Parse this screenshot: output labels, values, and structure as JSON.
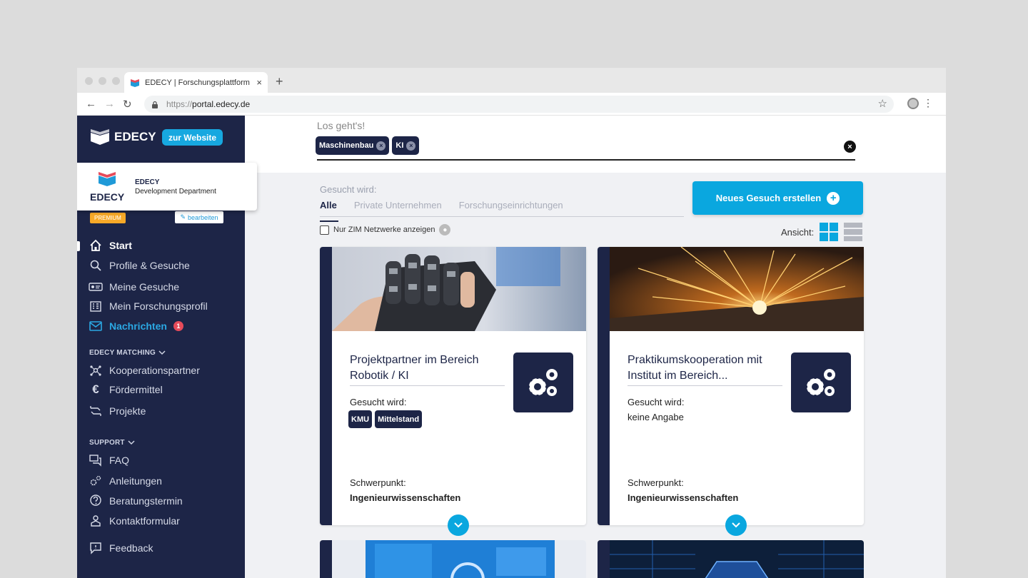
{
  "browser": {
    "tab_title": "EDECY | Forschungsplattform",
    "tab_close": "×",
    "new_tab": "+",
    "url_protocol": "https://",
    "url_host": "portal.edecy.de",
    "back": "←",
    "forward": "→",
    "reload": "↻",
    "star": "☆",
    "menu": "⋮"
  },
  "sidebar": {
    "brand": "EDECY",
    "website_button": "zur Website",
    "profile": {
      "logo_text": "EDECY",
      "name": "EDECY",
      "department": "Development Department",
      "premium": "PREMIUM",
      "edit": "bearbeiten"
    },
    "items": [
      {
        "label": "Start",
        "icon": "home-icon"
      },
      {
        "label": "Profile & Gesuche",
        "icon": "search-icon"
      },
      {
        "label": "Meine Gesuche",
        "icon": "id-card-icon"
      },
      {
        "label": "Mein Forschungsprofil",
        "icon": "building-icon"
      },
      {
        "label": "Nachrichten",
        "icon": "mail-icon",
        "badge": "1"
      }
    ],
    "matching": {
      "heading": "EDECY MATCHING",
      "items": [
        {
          "label": "Kooperationspartner",
          "icon": "network-icon"
        },
        {
          "label": "Fördermittel",
          "icon": "euro-icon"
        },
        {
          "label": "Projekte",
          "icon": "project-icon"
        }
      ]
    },
    "support": {
      "heading": "SUPPORT",
      "items": [
        {
          "label": "FAQ",
          "icon": "chat-icon"
        },
        {
          "label": "Anleitungen",
          "icon": "gears-icon"
        },
        {
          "label": "Beratungstermin",
          "icon": "question-icon"
        },
        {
          "label": "Kontaktformular",
          "icon": "contact-icon"
        }
      ]
    },
    "feedback": {
      "label": "Feedback",
      "icon": "feedback-icon"
    }
  },
  "search": {
    "prompt": "Los geht's!",
    "chips": [
      "Maschinenbau",
      "KI"
    ],
    "chip_remove": "×",
    "clear": "×"
  },
  "filters": {
    "label": "Gesucht wird:",
    "tabs": [
      "Alle",
      "Private Unternehmen",
      "Forschungseinrichtungen"
    ],
    "zim_label": "Nur ZIM Netzwerke anzeigen",
    "view_label": "Ansicht:"
  },
  "new_button": "Neues Gesuch erstellen",
  "cards": [
    {
      "title_line1": "Projektpartner im Bereich",
      "title_line2": "Robotik / KI",
      "sought_label": "Gesucht wird:",
      "tags": [
        "KMU",
        "Mittelstand"
      ],
      "focus_label": "Schwerpunkt:",
      "focus_value": "Ingenieurwissenschaften"
    },
    {
      "title_line1": "Praktikumskooperation mit",
      "title_line2": "Institut im Bereich...",
      "sought_label": "Gesucht wird:",
      "sought_value": "keine Angabe",
      "focus_label": "Schwerpunkt:",
      "focus_value": "Ingenieurwissenschaften"
    }
  ],
  "colors": {
    "navy": "#1d2547",
    "accent": "#0aa7df",
    "badge": "#e64b5a",
    "premium": "#f7a928"
  }
}
